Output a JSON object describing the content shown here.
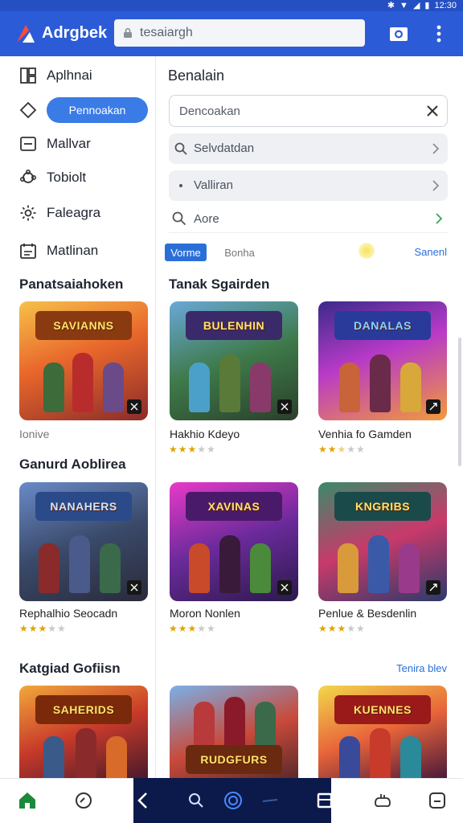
{
  "statusbar": {
    "time": "12:30"
  },
  "appbar": {
    "title": "Adrgbek",
    "url": "tesaiargh",
    "brand_color": "#2b5bd7"
  },
  "sidebar": {
    "items": [
      {
        "label": "Aplhnai",
        "icon": "apps-icon"
      },
      {
        "label": "Pennoakan",
        "icon": "home-icon",
        "active": true
      },
      {
        "label": "Mallvar",
        "icon": "mail-icon"
      },
      {
        "label": "Tobiolt",
        "icon": "puzzle-icon"
      },
      {
        "label": "Faleagra",
        "icon": "gear-icon"
      },
      {
        "label": "Matlinan",
        "icon": "calendar-icon"
      }
    ]
  },
  "panel": {
    "title": "Benalain",
    "search_value": "Dencoakan",
    "suggestions": [
      {
        "text": "Selvdatdan",
        "icon": "search-icon"
      },
      {
        "text": "Valliran",
        "icon": "dot-icon"
      },
      {
        "text": "Aore",
        "icon": "search-icon"
      }
    ],
    "chips": [
      "Vorme",
      "Bonha"
    ],
    "chips_link": "Sanenl"
  },
  "sections": [
    {
      "title": "Panatsaiahoken",
      "link": ""
    },
    {
      "title": "Tanak Sgairden",
      "link": ""
    },
    {
      "title": "Ganurd Aoblirea",
      "link": ""
    },
    {
      "title": "Katgiad Gofiisn",
      "link": "Tenira blev"
    }
  ],
  "cards": [
    {
      "art": "SAVIANNS",
      "caption": "Ionive",
      "rating": 0
    },
    {
      "art": "BULENHIN",
      "caption": "Hakhio Kdeyo",
      "rating": 3
    },
    {
      "art": "DANALAS",
      "caption": "Venhia fo Gamden",
      "rating": 2.5
    },
    {
      "art": "NANAHERS",
      "caption": "Rephalhio Seocadn",
      "rating": 3
    },
    {
      "art": "XAVINAS",
      "caption": "Moron Nonlen",
      "rating": 3
    },
    {
      "art": "KNGRIBS",
      "caption": "Penlue & Besdenlin",
      "rating": 3
    },
    {
      "art": "SAHERIDS",
      "caption": "",
      "rating": 0
    },
    {
      "art": "RUDGFURS",
      "caption": "",
      "rating": 0
    },
    {
      "art": "KUENNES",
      "caption": "",
      "rating": 0
    }
  ]
}
